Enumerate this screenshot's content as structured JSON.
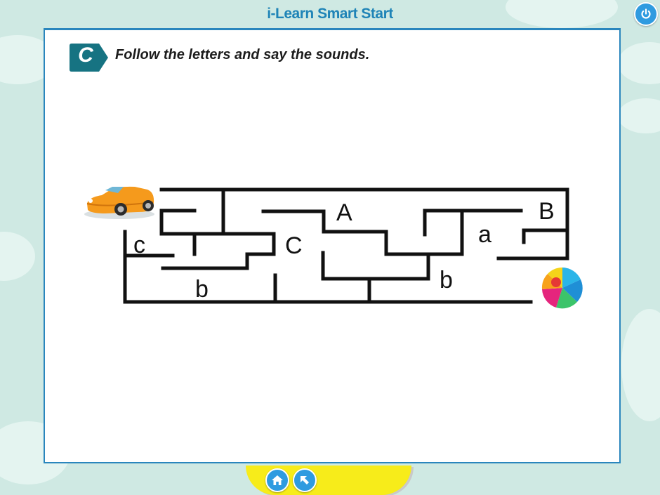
{
  "header": {
    "title": "i-Learn Smart Start",
    "power_icon": "power-icon"
  },
  "exercise": {
    "badge": "C",
    "instruction": "Follow the letters and say the sounds."
  },
  "maze": {
    "start_image": "car-icon",
    "end_image": "beach-ball-icon",
    "letters": [
      "c",
      "b",
      "C",
      "A",
      "b",
      "a",
      "B"
    ]
  },
  "footer": {
    "home_icon": "home-icon",
    "back_icon": "back-arrow-icon"
  },
  "colors": {
    "background": "#cfe9e3",
    "accent": "#2f9be0",
    "title": "#1f84b7",
    "badge": "#167382",
    "footer_bar": "#f7ec1a"
  }
}
